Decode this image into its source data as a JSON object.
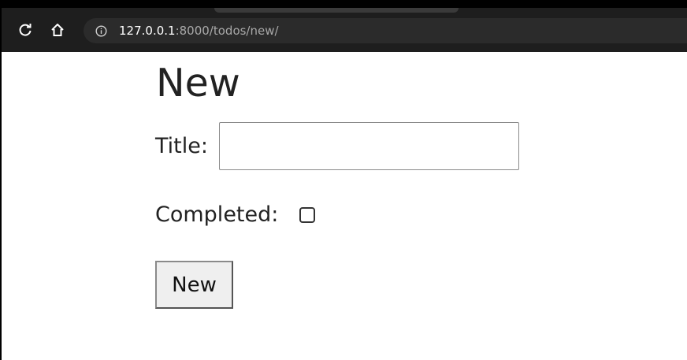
{
  "browser": {
    "address_bar": {
      "host": "127.0.0.1",
      "path": ":8000/todos/new/"
    },
    "icons": {
      "reload": "reload-icon",
      "home": "home-icon",
      "info": "info-icon"
    }
  },
  "page": {
    "heading": "New",
    "form": {
      "title_label": "Title:",
      "title_value": "",
      "completed_label": "Completed:",
      "completed_checked": false,
      "submit_label": "New"
    }
  }
}
